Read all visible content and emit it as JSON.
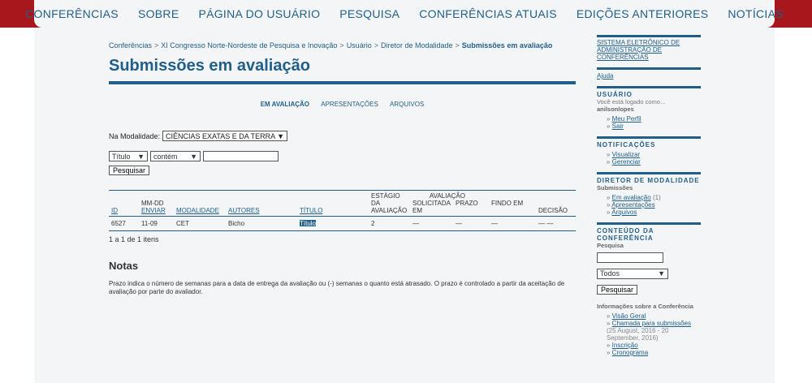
{
  "nav": {
    "items": [
      "CONFERÊNCIAS",
      "SOBRE",
      "PÁGINA DO USUÁRIO",
      "PESQUISA",
      "CONFERÊNCIAS ATUAIS",
      "EDIÇÕES ANTERIORES",
      "NOTÍCIAS"
    ]
  },
  "breadcrumb": {
    "items": [
      "Conferências",
      "XI Congresso Norte-Nordeste de Pesquisa e Inovação",
      "Usuário",
      "Diretor de Modalidade"
    ],
    "current": "Submissões em avaliação",
    "separator": ">"
  },
  "page_title": "Submissões em avaliação",
  "subtabs": [
    "EM AVALIAÇÃO",
    "APRESENTAÇÕES",
    "ARQUIVOS"
  ],
  "filter": {
    "label": "Na Modalidade:",
    "selected": "CIÊNCIAS EXATAS E DA TERRA"
  },
  "search": {
    "field_selected": "Título",
    "match_selected": "contém",
    "value": "",
    "button": "Pesquisar"
  },
  "table": {
    "headers": {
      "id": "ID",
      "date_top": "MM-DD",
      "date_link": "ENVIAR",
      "modality": "MODALIDADE",
      "authors": "AUTORES",
      "title": "TÍTULO",
      "stage_1": "ESTÁGIO DA",
      "stage_2": "AVALIAÇÃO",
      "review_group": "AVALIAÇÃO",
      "requested": "SOLICITADA",
      "requested_2": "EM",
      "deadline": "PRAZO",
      "done": "FINDO EM",
      "decision": "DECISÃO"
    },
    "rows": [
      {
        "id": "6527",
        "date": "11-09",
        "modality": "CET",
        "authors": "Bicho",
        "title": "Título",
        "stage": "2",
        "requested": "—",
        "deadline": "—",
        "done": "—",
        "decision": "— —"
      }
    ],
    "count_text": "1 a 1 de 1 itens"
  },
  "notes": {
    "heading": "Notas",
    "text": "Prazo indica o número de semanas para a data de entrega da avaliação ou (-) semanas o quanto está atrasado. O prazo é controlado a partir da aceitação de avaliação por parte do avaliador."
  },
  "sidebar": {
    "system_link": "SISTEMA ELETRÔNICO DE ADMINISTRAÇÃO DE CONFERÊNCIAS",
    "help": "Ajuda",
    "user": {
      "title": "USUÁRIO",
      "logged_text": "Você está logado como...",
      "username": "anilsonlopes",
      "links": [
        "Meu Perfil",
        "Sair"
      ]
    },
    "notifications": {
      "title": "NOTIFICAÇÕES",
      "links": [
        "Visualizar",
        "Gerenciar"
      ]
    },
    "director": {
      "title": "DIRETOR DE MODALIDADE",
      "subtitle": "Submissões",
      "links": [
        {
          "label": "Em avaliação",
          "count": "(1)"
        },
        {
          "label": "Apresentações",
          "count": ""
        },
        {
          "label": "Arquivos",
          "count": ""
        }
      ]
    },
    "content": {
      "title": "CONTEÚDO DA CONFERÊNCIA",
      "search_label": "Pesquisa",
      "scope_selected": "Todos",
      "search_button": "Pesquisar",
      "info_heading": "Informações sobre a Conferência",
      "links": [
        "Visão Geral",
        "Chamada para submissões"
      ],
      "call_dates": "(25 August, 2016 - 20 September, 2016)",
      "links2": [
        "Inscrição",
        "Cronograma"
      ]
    }
  }
}
